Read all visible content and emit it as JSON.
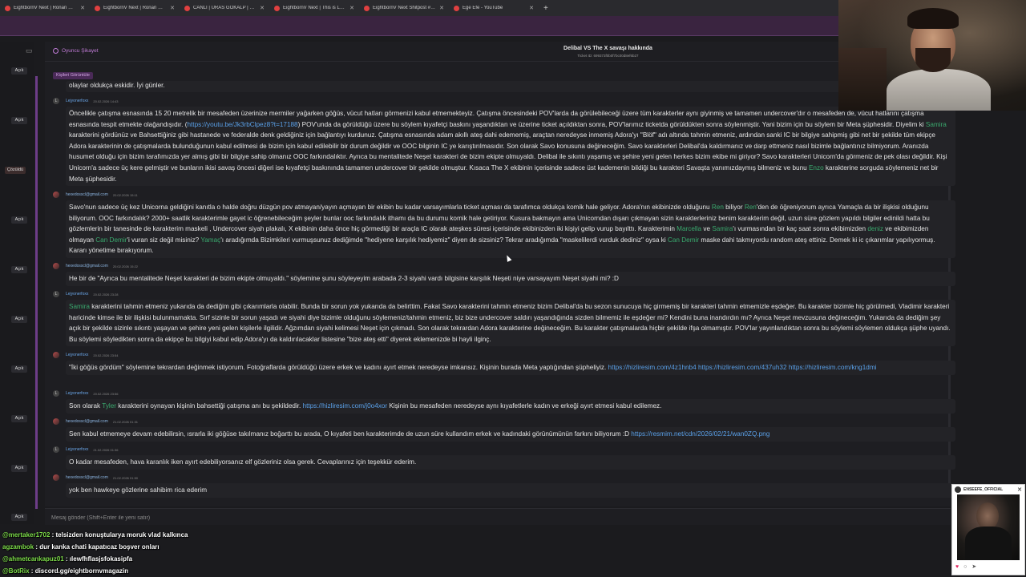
{
  "browser": {
    "tabs": [
      {
        "label": "EightbornV Next | Ronan Wag...",
        "color": "#e04040"
      },
      {
        "label": "EightbornV Next | Ronan Wag...",
        "color": "#e04040"
      },
      {
        "label": "CANLI | URAS GÖKALP | ÜC...",
        "color": "#e04040"
      },
      {
        "label": "EightbornV Next | This is LosSa...",
        "color": "#e04040"
      },
      {
        "label": "EightbornV Next Shitpost #16 ...",
        "color": "#e04040"
      },
      {
        "label": "Ege Efe - YouTube",
        "color": "#e04040"
      }
    ],
    "new_tab": "+"
  },
  "ticket": {
    "crumb": "Oyuncu Şikayet",
    "title": "Delibal VS The X savaşı hakkında",
    "ticket_id": "Ticket ID: 699373f0b0f7bc00d8ef6b27",
    "view_profile": "Kişileri Görüntüle",
    "status_buttons": [
      "Açık",
      "Açık",
      "Çözüldü",
      "Açık",
      "Açık",
      "Açık",
      "Açık",
      "Açık",
      "Açık"
    ],
    "bottom_status": "Açık"
  },
  "messages": {
    "m0": {
      "text": "olaylar oldukça eskidir. İyi günler."
    },
    "m1": {
      "author": "Lejyonerfoxx",
      "time": "20.02.2026 14:43",
      "avatar": "L",
      "p1": "Öncelikle çatışma esnasında 15 20 metrelik bir mesafeden üzerinize mermiler yağarken göğüs, vücut hatları görmenizi kabul etmemekteyiz. Çatışma öncesindeki POV'larda da görülebileceği üzere tüm karakterler aynı giyinmiş ve tamamen undercover'dır o mesafeden de, vücut hatlarını çatışma esnasında tespit etmekte olağandışıdır. (",
      "link1": "https://youtu.be/Jk3rbClpez8?t=17188",
      "p2": ") POV'unda da görüldüğü üzere bu söylem kıyafetçi baskını yaşandıktan ve üzerine ticket açıldıktan sonra, POV'larımız ticketda görüldükten sonra söylenmiştir. Yani bizim için bu söylem bir Meta şüphesidir. Diyelim ki ",
      "name1": "Samira",
      "p3": " karakterini gördünüz ve Bahsettiğiniz gibi hastanede ve federalde denk geldiğiniz için bağlantıyı kurdunuz. Çatışma esnasında adam akıllı ateş dahi edememiş, araçtan neredeyse inmemiş Adora'yı \"Blöf\" adı altında tahmin etmeniz, ardından sanki IC bir bilgiye sahipmiş gibi net bir şekilde tüm ekipçe Adora karakterinin de çatışmalarda bulunduğunun kabul edilmesi de bizim için kabul edilebilir bir durum değildir ve OOC bilginin IC ye karıştırılmasıdır. Son olarak Savo konusuna değineceğim. Savo karakterleri Delibal'da kaldırmanız ve darp ettmeniz nasıl bizimle bağlantınız bilmiyorum. Aranızda husumet olduğu için bizim tarafımızda yer almış gibi bir bilgiye sahip olmanız OOC farkındalıktır. Ayrıca bu mentalitede Neşet karakteri de bizim ekipte olmuyaldı. Delibal ile sıkıntı yaşamış ve şehire yeni gelen herkes bizim ekibe mi giriyor?  Savo karakterleri Unicorn'da görmeniz de pek olası değildir. Kişi Unicorn'a sadece üç kere gelmiştir ve bunların ikisi savaş öncesi diğeri ise kıyafetçi baskınında tamamen undercover bir şekilde olmuştur. Kısaca The X ekibinin içerisinde sadece üst kademenin bildiği bu karakteri Savaşta yanımızdaymış bilmeniz ve bunu ",
      "name2": "Enzo",
      "p4": " karakterine sorguda söylemeniz net bir Meta şüphesidir."
    },
    "m2": {
      "author": "hexedosscl@gmail.com",
      "time": "20.02.2026 15:11",
      "p1": "Savo'nun sadece üç kez Unicorna geldiğini kanıtla o halde doğru düzgün pov atmayan/yayın açmayan bir ekibin bu kadar varsayımlarla ticket açması da tarafımca oldukça komik hale geliyor. Adora'nın ekibinizde olduğunu ",
      "name1": "Ren",
      "p2": " biliyor ",
      "name2": "Ren",
      "p3": "'den de öğreniyorum ayrıca Yamaçla da bir ilişkisi olduğunu biliyorum. OOC farkındalık? 2000+ saatlik karakterimle gayet ic öğrenebileceğim şeyler bunlar ooc farkındalık ithamı da bu durumu komik hale getiriyor. Kusura bakmayın ama Unicorndan dışarı çıkmayan sizin karakterleriniz benim karakterim değil, uzun süre gözlem yapıldı bilgiler edinildi hatta bu gözlemlerin bir tanesinde de karakterim maskeli , Undercover siyah plakalı, X ekibinin daha önce hiç görmediği bir araçla IC olarak ateşkes süresi içerisinde ekibinizden iki kişiyi gelip vurup bayılttı. Karakterimin ",
      "name3": "Marcella",
      "p4": " ve ",
      "name4": "Samira",
      "p5": "'ı vurmasından bir kaç saat sonra ekibimizden ",
      "name5": "deniz",
      "p6": " ve ekibimizden olmayan ",
      "name6": "Can Demir",
      "p7": "'i vuran siz değil misiniz? ",
      "name7": "Yamaç",
      "p8": "'ı aradığımda Bizimkileri vurmuşsunuz dediğimde \"hediyene karşılık hediyemiz\" diyen de sizsiniz? Tekrar aradığımda \"maskelilerdi vurduk dediniz\" oysa ki ",
      "name8": "Can Demir",
      "p9": " maske dahi takmıyordu random ateş ettiniz. Demek ki ic çıkarımlar yapılıyormuş. Kararı yönetime bırakıyorum."
    },
    "m3": {
      "author": "hexedosscl@gmail.com",
      "time": "20.02.2026 15:22",
      "text": "He bir de \"Ayrıca bu mentalitede Neşet karakteri de bizim ekipte olmuyaldı.\" söylemine şunu söyleyeyim arabada 2-3 siyahi vardı bilgisine karşılık Neşeti niye varsayayım Neşet siyahi mi? :D"
    },
    "m4": {
      "author": "Lejyonerfoxx",
      "time": "20.02.2026 23:28",
      "avatar": "L",
      "name1": "Samira",
      "p1": " karakterini tahmin etmeniz yukarıda da dediğim gibi çıkarımlarla olabilir. Bunda bir sorun yok yukarıda da belirttim. Fakat Savo karakterini tahmin etmeniz bizim Delibal'da bu sezon sunucuya hiç girmemiş bir karakteri tahmin etmemizle eşdeğer. Bu karakter bizimle hiç görülmedi, Vladimir karakteri haricinde kimse ile bir ilişkisi bulunmamakta. Sırf sizinle bir sorun yaşadı ve siyahi diye bizimle olduğunu söylemeniz/tahmin etmeniz, biz bize undercover saldırı yaşandığında sizden bilmemiz ile eşdeğer mi? Kendini buna inandırdın mı? Ayrıca Neşet mevzusuna değineceğim. Yukarıda da dediğim şey açık bir şekilde sizinle sıkıntı yaşayan ve şehire yeni gelen kişilerle ilgilidir. Ağzımdan siyahi kelimesi Neşet için çıkmadı. Son olarak tekrardan Adora karakterine değineceğim. Bu karakter çatışmalarda hiçbir şekilde ifşa olmamıştır. POV'lar yayınlandıktan sonra bu söylemi söylemen oldukça şüphe uyandı. Bu söylemi söyledikten sonra da ekipçe bu bilgiyi kabul edip Adora'yı da kaldırılacaklar listesine \"bize ateş etti\" diyerek eklemenizde bi hayli ilginç."
    },
    "m5": {
      "author": "Lejyonerfoxx",
      "time": "20.02.2026 23:54",
      "p1": "\"İki göğüs gördüm\" söylemine tekrardan değinmek istiyorum. Fotoğraflarda görüldüğü üzere erkek ve kadını ayırt etmek neredeyse imkansız. Kişinin burada Meta yaptığından şüpheliyiz. ",
      "link1": "https://hizliresim.com/4z1hnb4",
      "link2": "https://hizliresim.com/437uh32",
      "link3": "https://hizliresim.com/kng1dmi"
    },
    "m6": {
      "author": "Lejyonerfoxx",
      "time": "20.02.2026 23:56",
      "avatar": "L",
      "p1": "Son olarak ",
      "name1": "Tyler",
      "p2": " karakterini oynayan kişinin bahsettiği çatışma anı bu şekildedir. ",
      "link1": "https://hizliresim.com/j0o4xor",
      "p3": " Kişinin bu mesafeden neredeyse aynı kıyafetlerle kadın ve erkeği  ayırt etmesi kabul edilemez."
    },
    "m7": {
      "author": "hexedosscl@gmail.com",
      "time": "21.02.2026 01:31",
      "p1": "Sen kabul etmemeye devam edebilirsin, ısrarla iki göğüse takılmanız boğarttı bu arada, O kıyafeti ben karakterimde de uzun süre kullandım erkek ve kadındaki görünümünün farkını biliyorum :D ",
      "link1": "https://resmim.net/cdn/2026/02/21/wan0ZQ.png"
    },
    "m8": {
      "author": "Lejyonerfoxx",
      "time": "21.02.2026 01:36",
      "avatar": "L",
      "text": "O kadar mesafeden, hava karanlık iken ayırt edebiliyorsanız elf gözleriniz olsa gerek. Cevaplarınız için teşekkür ederim."
    },
    "m9": {
      "author": "hexedosscl@gmail.com",
      "time": "21.02.2026 01:50",
      "text": "yok ben hawkeye gözlerine sahibim rica ederim"
    }
  },
  "input": {
    "placeholder": "Mesaj gönder (Shift+Enter ile yeni satır)"
  },
  "stream_chat": [
    {
      "user": "@mertaker1702",
      "text": " : telsizden konuştularya moruk vlad kalkınca"
    },
    {
      "user": "agzambok",
      "text": " : dur kanka chati kapatıcaz boşver onları"
    },
    {
      "user": "@ahmetcankapuz01",
      "text": " : ılewfhflasjsfokasipfa"
    },
    {
      "user": "@BotRix",
      "text": " : discord.gg/eightbornvmagazin"
    }
  ],
  "popup": {
    "handle": "ENSEEFE_OFFICIAL"
  },
  "colors": {
    "accent": "#6d3d88",
    "link": "#5aa0e8",
    "name": "#3aaa6e"
  }
}
